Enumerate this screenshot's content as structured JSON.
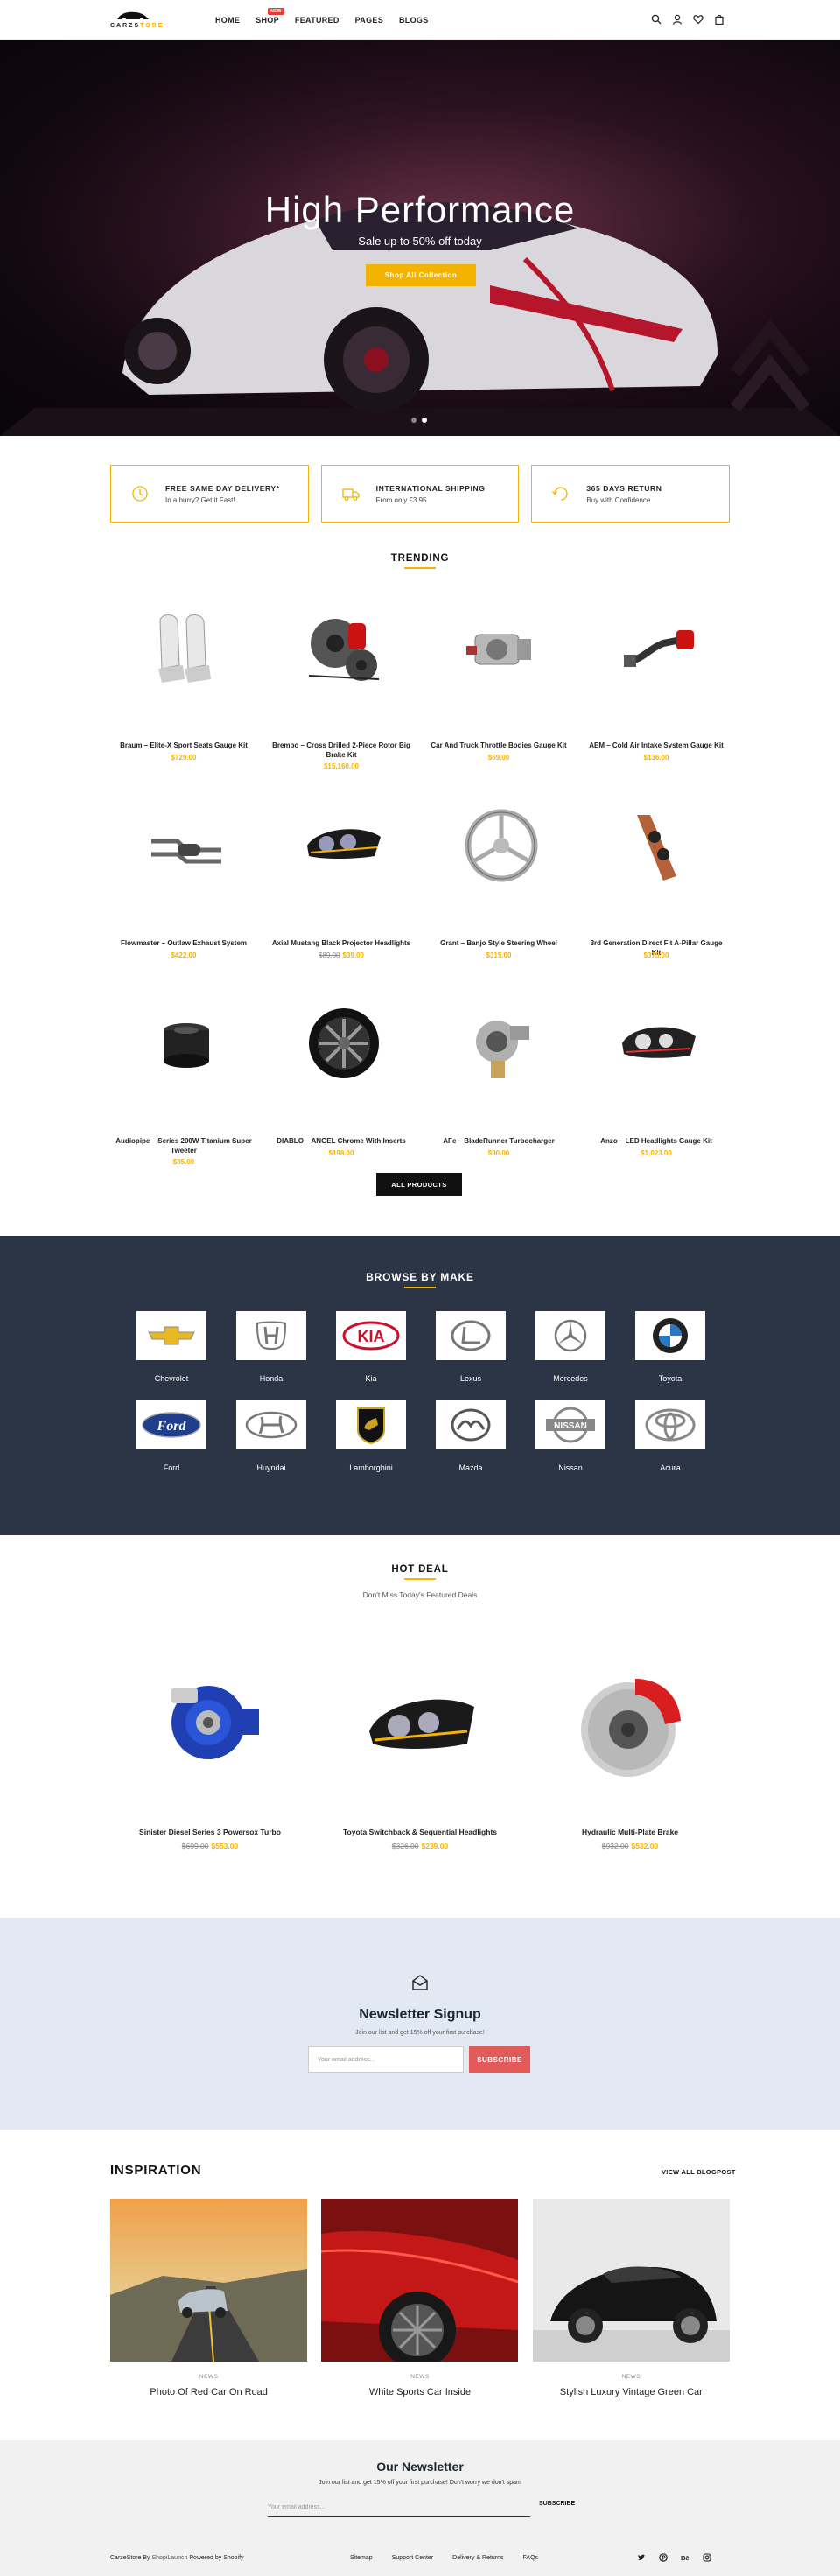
{
  "header": {
    "logo_main": "CARZS",
    "logo_accent": "TORE",
    "nav": [
      "HOME",
      "SHOP",
      "FEATURED",
      "PAGES",
      "BLOGS"
    ],
    "shop_badge": "NEW",
    "icons": [
      "search-icon",
      "user-icon",
      "heart-icon",
      "bag-icon"
    ]
  },
  "hero": {
    "title": "High Performance",
    "subtitle": "Sale up to 50% off today",
    "button": "Shop All Collection",
    "slides": 2,
    "active_slide": 2
  },
  "features": [
    {
      "title": "FREE SAME DAY DELIVERY*",
      "desc": "In a hurry? Get it Fast!",
      "icon": "delivery-icon"
    },
    {
      "title": "INTERNATIONAL SHIPPING",
      "desc": "From only £3.95",
      "icon": "truck-icon"
    },
    {
      "title": "365 DAYS RETURN",
      "desc": "Buy with Confidence",
      "icon": "return-icon"
    }
  ],
  "trending": {
    "title": "TRENDING",
    "products": [
      {
        "name": "Braum – Elite-X Sport Seats Gauge Kit",
        "price": "$729.00",
        "old": "",
        "icon": "car-seats-icon"
      },
      {
        "name": "Brembo – Cross Drilled 2-Piece Rotor Big Brake Kit",
        "price": "$15,160.00",
        "old": "",
        "icon": "brake-kit-icon"
      },
      {
        "name": "Car And Truck Throttle Bodies Gauge Kit",
        "price": "$69.00",
        "old": "",
        "icon": "throttle-body-icon"
      },
      {
        "name": "AEM – Cold Air Intake System Gauge Kit",
        "price": "$136.00",
        "old": "",
        "icon": "air-intake-icon"
      },
      {
        "name": "Flowmaster – Outlaw Exhaust System",
        "price": "$422.00",
        "old": "",
        "icon": "exhaust-icon"
      },
      {
        "name": "Axial Mustang Black Projector Headlights",
        "price": "$39.00",
        "old": "$89.00",
        "icon": "headlight-icon"
      },
      {
        "name": "Grant – Banjo Style Steering Wheel",
        "price": "$315.00",
        "old": "",
        "icon": "steering-wheel-icon"
      },
      {
        "name": "3rd Generation Direct Fit A-Pillar Gauge Kit",
        "price": "$375.00",
        "old": "",
        "icon": "a-pillar-icon"
      },
      {
        "name": "Audiopipe – Series 200W Titanium Super Tweeter",
        "price": "$85.00",
        "old": "",
        "icon": "tweeter-icon"
      },
      {
        "name": "DIABLO – ANGEL Chrome With Inserts",
        "price": "$198.00",
        "old": "",
        "icon": "rim-icon"
      },
      {
        "name": "AFe – BladeRunner Turbocharger",
        "price": "$90.00",
        "old": "",
        "icon": "turbo-icon"
      },
      {
        "name": "Anzo – LED Headlights Gauge Kit",
        "price": "$1,023.00",
        "old": "",
        "icon": "led-headlight-icon"
      }
    ],
    "all_button": "ALL PRODUCTS"
  },
  "makes": {
    "title": "BROWSE BY MAKE",
    "items": [
      "Chevrolet",
      "Honda",
      "Kia",
      "Lexus",
      "Mercedes",
      "Toyota",
      "Ford",
      "Huyndai",
      "Lamborghini",
      "Mazda",
      "Nissan",
      "Acura"
    ]
  },
  "hot_deal": {
    "title": "HOT DEAL",
    "subtitle": "Don't Miss Today's Featured Deals",
    "items": [
      {
        "name": "Sinister Diesel Series 3 Powersox Turbo",
        "old": "$699.00",
        "price": "$553.00",
        "icon": "blue-turbo-icon"
      },
      {
        "name": "Toyota Switchback & Sequential Headlights",
        "old": "$326.00",
        "price": "$239.00",
        "icon": "headlight-icon"
      },
      {
        "name": "Hydraulic Multi-Plate Brake",
        "old": "$932.00",
        "price": "$532.00",
        "icon": "red-brake-icon"
      }
    ]
  },
  "newsletter": {
    "title": "Newsletter Signup",
    "subtitle": "Join our list and get 15% off your first purchase!",
    "placeholder": "Your email address...",
    "button": "SUBSCRIBE"
  },
  "inspiration": {
    "title": "INSPIRATION",
    "link": "VIEW ALL BLOGPOST",
    "posts": [
      {
        "tag": "NEWS",
        "title": "Photo Of Red Car On Road"
      },
      {
        "tag": "NEWS",
        "title": "White Sports Car Inside"
      },
      {
        "tag": "NEWS",
        "title": "Stylish Luxury Vintage Green Car"
      }
    ]
  },
  "footer": {
    "title": "Our Newsletter",
    "subtitle": "Join our list and get 15% off your first purchase! Don't worry we don't spam",
    "placeholder": "Your email address...",
    "button": "SUBSCRIBE",
    "copy_brand": "CarzeStore By",
    "copy_link": "ShopiLaunch",
    "copy_powered": "Powered by Shopify",
    "links": [
      "Sitemap",
      "Support Center",
      "Delivery & Returns",
      "FAQs"
    ],
    "social": [
      "twitter-icon",
      "pinterest-icon",
      "behance-icon",
      "instagram-icon"
    ]
  },
  "colors": {
    "accent": "#f5b301",
    "dark_panel": "#2b3545",
    "newsletter_bg": "#e3e9f3",
    "subscribe": "#e25a5a"
  }
}
